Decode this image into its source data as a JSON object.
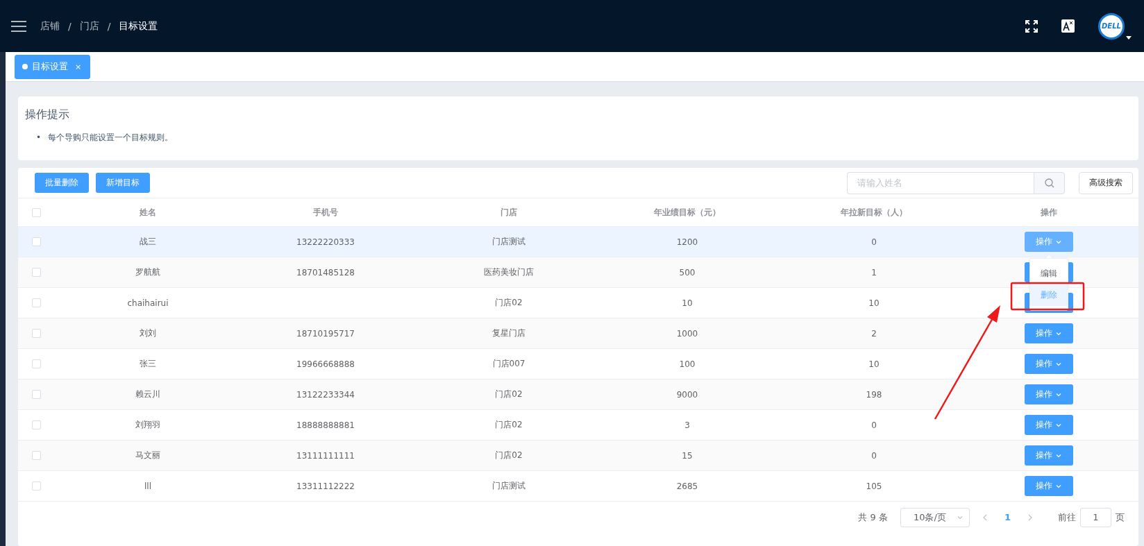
{
  "header": {
    "breadcrumb": [
      {
        "label": "店铺",
        "current": false
      },
      {
        "label": "门店",
        "current": false
      },
      {
        "label": "目标设置",
        "current": true
      }
    ],
    "separator": "/",
    "avatar_text": "DELL"
  },
  "tabs": [
    {
      "label": "目标设置",
      "selected": true,
      "close": "×"
    }
  ],
  "tip": {
    "title": "操作提示",
    "bullet": "•",
    "items": [
      "每个导购只能设置一个目标规则。"
    ]
  },
  "toolbar": {
    "buttons": [
      "批量删除",
      "新增目标"
    ],
    "search": {
      "placeholder": "请输入姓名"
    },
    "advanced": "高级搜索"
  },
  "table": {
    "header_checked": false,
    "columns": [
      "姓名",
      "手机号",
      "门店",
      "年业绩目标（元）",
      "年拉新目标（人）",
      "操作"
    ],
    "rows": [
      {
        "checked": false,
        "highlighted": true,
        "name": "战三",
        "phone": "13222220333",
        "store": "门店测试",
        "sales": "1200",
        "new": "0",
        "action": "操作"
      },
      {
        "checked": false,
        "highlighted": false,
        "name": "罗航航",
        "phone": "18701485128",
        "store": "医药美妆门店",
        "sales": "500",
        "new": "1"
      },
      {
        "checked": false,
        "highlighted": false,
        "name": "chaihairui",
        "phone": "",
        "store": "门店02",
        "sales": "10",
        "new": "10"
      },
      {
        "checked": false,
        "highlighted": false,
        "name": "刘刘",
        "phone": "18710195717",
        "store": "复星门店",
        "sales": "1000",
        "new": "2",
        "action": "操作"
      },
      {
        "checked": false,
        "highlighted": false,
        "name": "张三",
        "phone": "19966668888",
        "store": "门店007",
        "sales": "100",
        "new": "10",
        "action": "操作"
      },
      {
        "checked": false,
        "highlighted": false,
        "name": "赖云川",
        "phone": "13122233344",
        "store": "门店02",
        "sales": "9000",
        "new": "198",
        "action": "操作"
      },
      {
        "checked": false,
        "highlighted": false,
        "name": "刘翔羽",
        "phone": "18888888881",
        "store": "门店02",
        "sales": "3",
        "new": "0",
        "action": "操作"
      },
      {
        "checked": false,
        "highlighted": false,
        "name": "马文丽",
        "phone": "13111111111",
        "store": "门店02",
        "sales": "15",
        "new": "0",
        "action": "操作"
      },
      {
        "checked": false,
        "highlighted": false,
        "name": "lll",
        "phone": "13311112222",
        "store": "门店测试",
        "sales": "2685",
        "new": "105",
        "action": "操作"
      }
    ]
  },
  "dropdown": {
    "items": [
      {
        "label": "编辑",
        "selected": false
      },
      {
        "label": "删除",
        "selected": true
      }
    ]
  },
  "pagination": {
    "total": "共 9 条",
    "page_size": "10条/页",
    "pages": [
      {
        "label": "1",
        "selected": true
      }
    ],
    "goto_label": "前往",
    "goto_value": "1",
    "page_unit": "页"
  }
}
